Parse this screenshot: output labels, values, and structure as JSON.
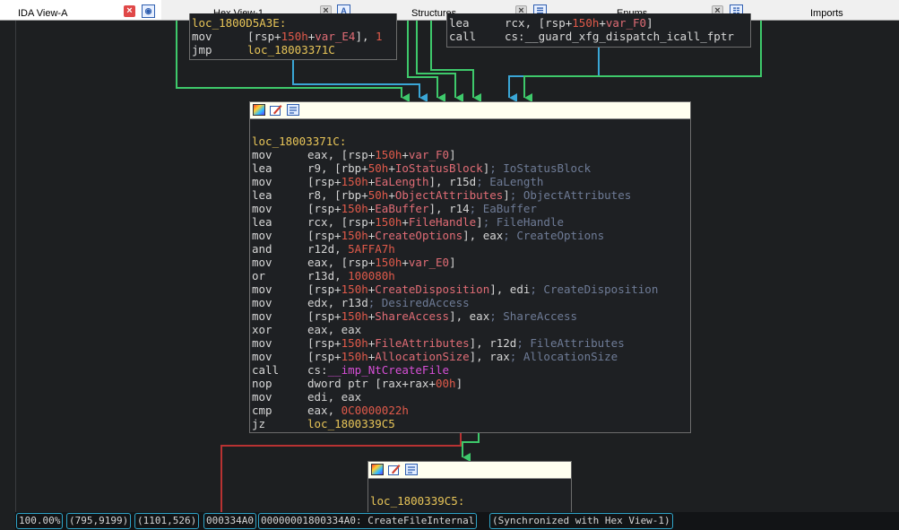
{
  "tabs": [
    {
      "label": "IDA View-A",
      "close": "close-icon",
      "icon": "ida-view-icon"
    },
    {
      "label": "Hex View-1",
      "close": "close-icon",
      "icon": "hex-view-icon"
    },
    {
      "label": "Structures",
      "close": "close-icon",
      "icon": "structures-icon"
    },
    {
      "label": "Enums",
      "close": "close-icon",
      "icon": "enums-icon"
    },
    {
      "label": "Imports"
    }
  ],
  "colors": {
    "background": "#1d1f21",
    "edge_green": "#3ec96b",
    "edge_blue": "#3aa6d6",
    "edge_red": "#b83232",
    "label": "#e8c558",
    "comment": "#6e7b96",
    "number": "#e05a4a"
  },
  "node_top_left": [
    {
      "text": "loc_1800D5A3E:"
    },
    {
      "mn": "mov",
      "ops": "[rsp+150h+var_E4], 1"
    },
    {
      "mn": "jmp",
      "ops": "loc_18003371C"
    }
  ],
  "node_top_right": [
    {
      "mn": "lea",
      "ops": "rcx, [rsp+150h+var_F0]"
    },
    {
      "mn": "call",
      "ops": "cs:__guard_xfg_dispatch_icall_fptr"
    }
  ],
  "node_main": {
    "label": "loc_18003371C:",
    "lines": [
      {
        "mn": "mov",
        "ops": "eax, [rsp+150h+var_F0]",
        "cmt": ""
      },
      {
        "mn": "lea",
        "ops": "r9, [rbp+50h+IoStatusBlock]",
        "cmt": "; IoStatusBlock"
      },
      {
        "mn": "mov",
        "ops": "[rsp+150h+EaLength], r15d",
        "cmt": "; EaLength"
      },
      {
        "mn": "lea",
        "ops": "r8, [rbp+50h+ObjectAttributes]",
        "cmt": "; ObjectAttributes"
      },
      {
        "mn": "mov",
        "ops": "[rsp+150h+EaBuffer], r14",
        "cmt": "; EaBuffer"
      },
      {
        "mn": "lea",
        "ops": "rcx, [rsp+150h+FileHandle]",
        "cmt": "; FileHandle"
      },
      {
        "mn": "mov",
        "ops": "[rsp+150h+CreateOptions], eax",
        "cmt": "; CreateOptions"
      },
      {
        "mn": "and",
        "ops": "r12d, 5AFFA7h",
        "cmt": ""
      },
      {
        "mn": "mov",
        "ops": "eax, [rsp+150h+var_E0]",
        "cmt": ""
      },
      {
        "mn": "or",
        "ops": "r13d, 100080h",
        "cmt": ""
      },
      {
        "mn": "mov",
        "ops": "[rsp+150h+CreateDisposition], edi",
        "cmt": "; CreateDisposition"
      },
      {
        "mn": "mov",
        "ops": "edx, r13d",
        "cmt": "; DesiredAccess"
      },
      {
        "mn": "mov",
        "ops": "[rsp+150h+ShareAccess], eax",
        "cmt": "; ShareAccess"
      },
      {
        "mn": "xor",
        "ops": "eax, eax",
        "cmt": ""
      },
      {
        "mn": "mov",
        "ops": "[rsp+150h+FileAttributes], r12d",
        "cmt": "; FileAttributes"
      },
      {
        "mn": "mov",
        "ops": "[rsp+150h+AllocationSize], rax",
        "cmt": "; AllocationSize"
      },
      {
        "mn": "call",
        "ops": "cs:__imp_NtCreateFile",
        "cmt": ""
      },
      {
        "mn": "nop",
        "ops": "dword ptr [rax+rax+00h]",
        "cmt": ""
      },
      {
        "mn": "mov",
        "ops": "edi, eax",
        "cmt": ""
      },
      {
        "mn": "cmp",
        "ops": "eax, 0C0000022h",
        "cmt": ""
      },
      {
        "mn": "jz",
        "ops": "loc_1800339C5",
        "cmt": ""
      }
    ]
  },
  "node_bottom": {
    "label": "loc_1800339C5:"
  },
  "status": {
    "zoom": "100.00%",
    "coords1": "(795,9199)",
    "coords2": "(1101,526)",
    "offset": "000334A0",
    "address": "00000001800334A0: CreateFileInternal",
    "sync": "(Synchronized with Hex View-1)"
  }
}
